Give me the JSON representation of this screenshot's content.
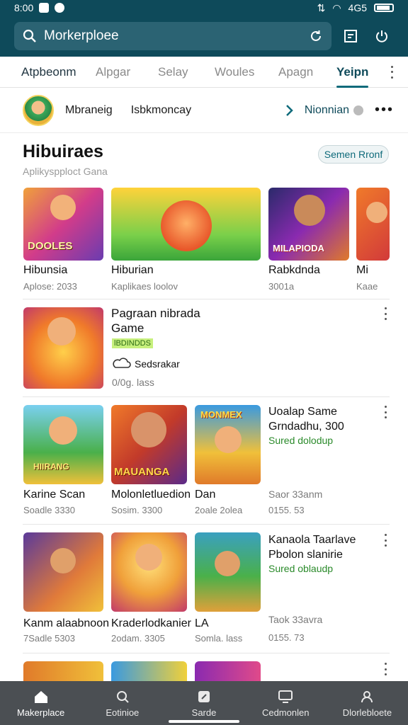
{
  "status_bar": {
    "time": "8:00",
    "network": "4G5"
  },
  "search": {
    "value": "Morkerploee"
  },
  "tabs": [
    "Atpbeonm",
    "Alpgar",
    "Selay",
    "Woules",
    "Apagn",
    "Yeipn"
  ],
  "profile_row": {
    "name_a": "Mbraneig",
    "name_b": "Isbkmoncay",
    "region": "Nionnian"
  },
  "section": {
    "title": "Hibuiraes",
    "subtitle": "Aplikyspploct Gana",
    "pill": "Semen Rronf"
  },
  "row1": [
    {
      "title": "Hibunsia",
      "sub": "Aplose: 2033",
      "art": "DOOLES"
    },
    {
      "title": "Hiburian",
      "sub": "Kaplikaes loolov"
    },
    {
      "title": "Rabkdnda",
      "sub": "3001a",
      "art": "MILAPIODA"
    },
    {
      "title": "Mi",
      "sub": "Kaae"
    }
  ],
  "feature1": {
    "title_line1": "Pagraan nibrada",
    "title_line2": "Game",
    "tag": "lBDINDDS",
    "status": "Sedsrakar",
    "meta": "0/0g. lass"
  },
  "grid1": [
    {
      "title": "Karine Scan",
      "sub": "Soadle 3330",
      "art": "HIIRANG"
    },
    {
      "title": "Molonletluedion",
      "sub": "Sosim. 3300",
      "art": "MAUANGA"
    },
    {
      "title": "Dan",
      "sub": "2oale 2olea",
      "art": "MONMEX"
    }
  ],
  "side1": {
    "line1": "Uoalap Same",
    "line2": "Grndadhu, 300",
    "green": "Sured dolodup",
    "meta_title": "Saor 33anm",
    "meta_sub": "0155. 53"
  },
  "grid2": [
    {
      "title": "Kanm alaabnoon",
      "sub": "7Sadle 5303"
    },
    {
      "title": "Kraderlodkanier",
      "sub": "2odam. 3305"
    },
    {
      "title": "LA",
      "sub": "Somla. lass"
    }
  ],
  "side2": {
    "line1": "Kanaola Taarlave",
    "line2": "Pbolon slanirie",
    "green": "Sured oblaudp",
    "meta_title": "Taok 33avra",
    "meta_sub": "0155. 73"
  },
  "bottom_nav": [
    "Makerplace",
    "Eotinioe",
    "Sarde",
    "Cedmonlen",
    "Dlorlebloete"
  ],
  "colors": {
    "header": "#0e4a5a",
    "accent": "#0e6a7a",
    "nav": "#4b4f53",
    "green": "#2a8a2a"
  }
}
